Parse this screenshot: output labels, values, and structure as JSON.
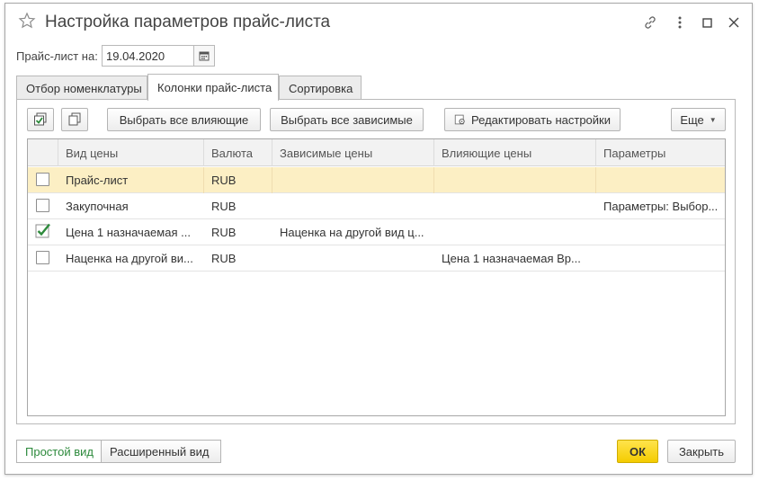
{
  "window": {
    "title": "Настройка параметров прайс-листа",
    "icons": [
      "star-icon",
      "link-icon",
      "more-icon",
      "maximize-icon",
      "close-icon"
    ]
  },
  "date": {
    "label": "Прайс-лист на:",
    "value": "19.04.2020",
    "button_icon": "calendar-icon"
  },
  "tabs": [
    {
      "label": "Отбор номенклатуры",
      "active": false
    },
    {
      "label": "Колонки прайс-листа",
      "active": true
    },
    {
      "label": "Сортировка",
      "active": false
    }
  ],
  "toolbar": {
    "check_all_icon": "check-all-icon",
    "copy_icon": "copy-icon",
    "select_influencing": "Выбрать все влияющие",
    "select_dependent": "Выбрать все зависимые",
    "edit_settings": "Редактировать настройки",
    "edit_settings_icon": "settings-icon",
    "more": "Еще"
  },
  "grid": {
    "columns": [
      "Вид цены",
      "Валюта",
      "Зависимые цены",
      "Влияющие цены",
      "Параметры"
    ],
    "rows": [
      {
        "checked": false,
        "selected": true,
        "price_type": "Прайс-лист",
        "currency": "RUB",
        "dependent": "",
        "influencing": "",
        "params": ""
      },
      {
        "checked": false,
        "selected": false,
        "price_type": "Закупочная",
        "currency": "RUB",
        "dependent": "",
        "influencing": "",
        "params": "Параметры: Выбор..."
      },
      {
        "checked": true,
        "selected": false,
        "price_type": "Цена 1 назначаемая ...",
        "currency": "RUB",
        "dependent": "Наценка на другой вид ц...",
        "influencing": "",
        "params": ""
      },
      {
        "checked": false,
        "selected": false,
        "price_type": "Наценка на другой ви...",
        "currency": "RUB",
        "dependent": "",
        "influencing": "Цена 1 назначаемая Вр...",
        "params": ""
      }
    ]
  },
  "footer": {
    "simple_view": "Простой вид",
    "extended_view": "Расширенный вид",
    "ok": "ОК",
    "close": "Закрыть"
  },
  "colors": {
    "accent_yellow": "#f4cc00",
    "selected_row": "#fcefc4",
    "check_green": "#2d8a3c"
  }
}
